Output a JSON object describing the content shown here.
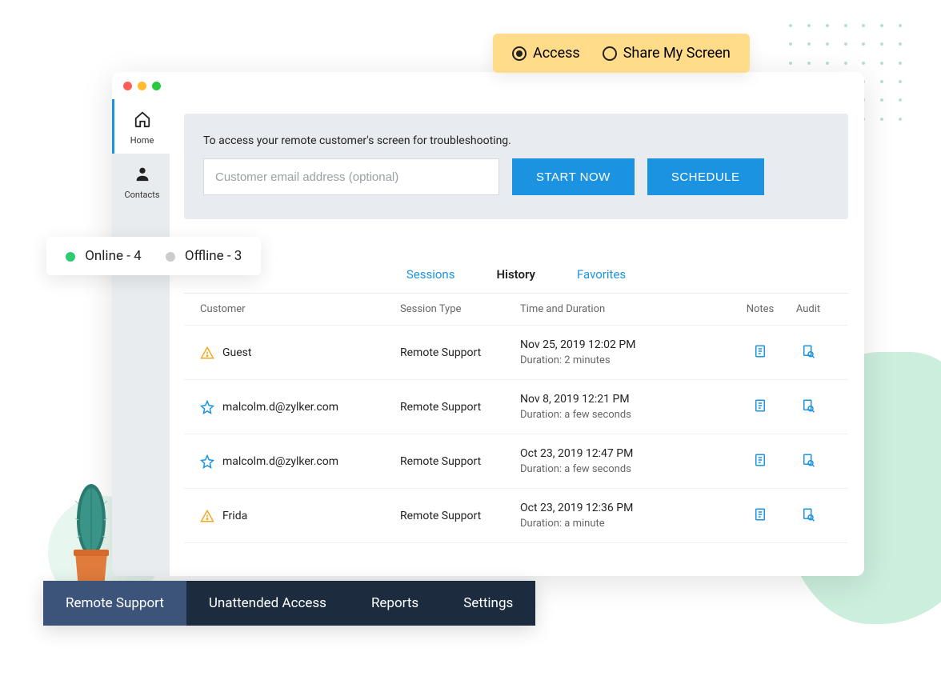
{
  "modeToggle": {
    "access": "Access",
    "share": "Share My Screen"
  },
  "statusChip": {
    "online_label": "Online - 4",
    "offline_label": "Offline - 3"
  },
  "sidebar": {
    "home": "Home",
    "contacts": "Contacts"
  },
  "accessPanel": {
    "description": "To access your remote customer's screen for troubleshooting.",
    "placeholder": "Customer email address (optional)",
    "startNow": "START NOW",
    "schedule": "SCHEDULE"
  },
  "tabs": {
    "sessions": "Sessions",
    "history": "History",
    "favorites": "Favorites"
  },
  "tableHeaders": {
    "customer": "Customer",
    "sessionType": "Session Type",
    "timeDuration": "Time and Duration",
    "notes": "Notes",
    "audit": "Audit"
  },
  "rows": [
    {
      "icon": "warning",
      "customer": "Guest",
      "type": "Remote Support",
      "datetime": "Nov 25, 2019 12:02 PM",
      "duration": "Duration: 2 minutes"
    },
    {
      "icon": "star",
      "customer": "malcolm.d@zylker.com",
      "type": "Remote Support",
      "datetime": "Nov 8, 2019 12:21 PM",
      "duration": "Duration: a few seconds"
    },
    {
      "icon": "star",
      "customer": "malcolm.d@zylker.com",
      "type": "Remote Support",
      "datetime": "Oct 23, 2019 12:47 PM",
      "duration": "Duration: a few seconds"
    },
    {
      "icon": "warning",
      "customer": "Frida",
      "type": "Remote Support",
      "datetime": "Oct 23, 2019 12:36 PM",
      "duration": "Duration: a minute"
    }
  ],
  "bottomNav": {
    "remoteSupport": "Remote Support",
    "unattended": "Unattended Access",
    "reports": "Reports",
    "settings": "Settings"
  }
}
